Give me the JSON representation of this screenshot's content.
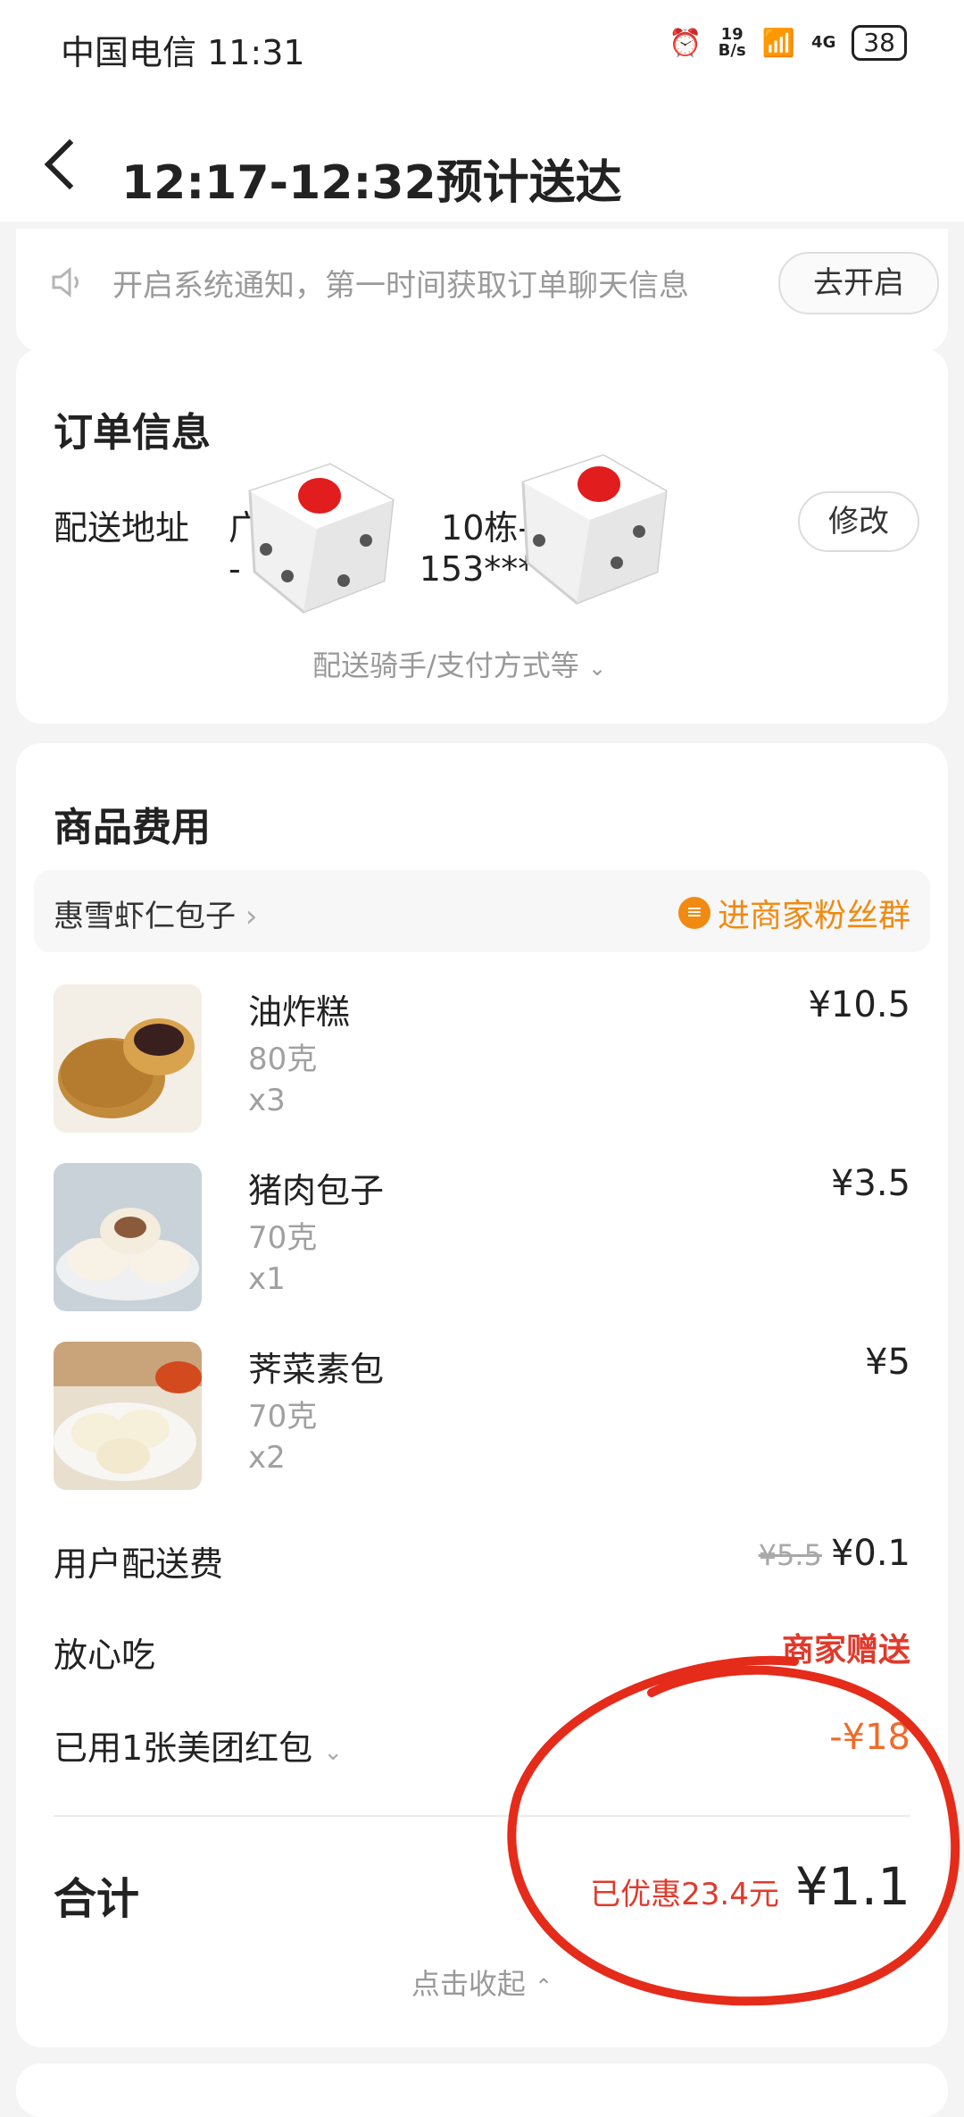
{
  "status_bar": {
    "carrier_time": "中国电信 11:31",
    "net_speed_value": "19",
    "net_speed_unit": "B/s",
    "network": "4G",
    "battery": "38"
  },
  "header": {
    "title": "12:17-12:32预计送达"
  },
  "notice": {
    "text": "开启系统通知，第一时间获取订单聊天信息",
    "button": "去开启"
  },
  "order_info": {
    "title": "订单信息",
    "address_label": "配送地址",
    "address_line1_start": "广",
    "address_line1_end": "10栋-",
    "address_line2_start": "-",
    "address_line2_end": "153***",
    "edit_button": "修改",
    "more_link": "配送骑手/支付方式等"
  },
  "fees": {
    "title": "商品费用",
    "shop_name": "惠雪虾仁包子",
    "fans_link": "进商家粉丝群",
    "items": [
      {
        "name": "油炸糕",
        "spec": "80克",
        "qty": "x3",
        "price": "¥10.5"
      },
      {
        "name": "猪肉包子",
        "spec": "70克",
        "qty": "x1",
        "price": "¥3.5"
      },
      {
        "name": "荠菜素包",
        "spec": "70克",
        "qty": "x2",
        "price": "¥5"
      }
    ],
    "delivery_label": "用户配送费",
    "delivery_original": "¥5.5",
    "delivery_price": "¥0.1",
    "safe_label": "放心吃",
    "safe_value": "商家赠送",
    "redpacket_label": "已用1张美团红包",
    "redpacket_value": "-¥18",
    "total_label": "合计",
    "saved_text": "已优惠23.4元",
    "total_price": "¥1.1",
    "collapse": "点击收起"
  },
  "colors": {
    "accent_orange": "#f08a12",
    "discount_red": "#e03a2c",
    "annotation_red": "#e52b1a"
  }
}
